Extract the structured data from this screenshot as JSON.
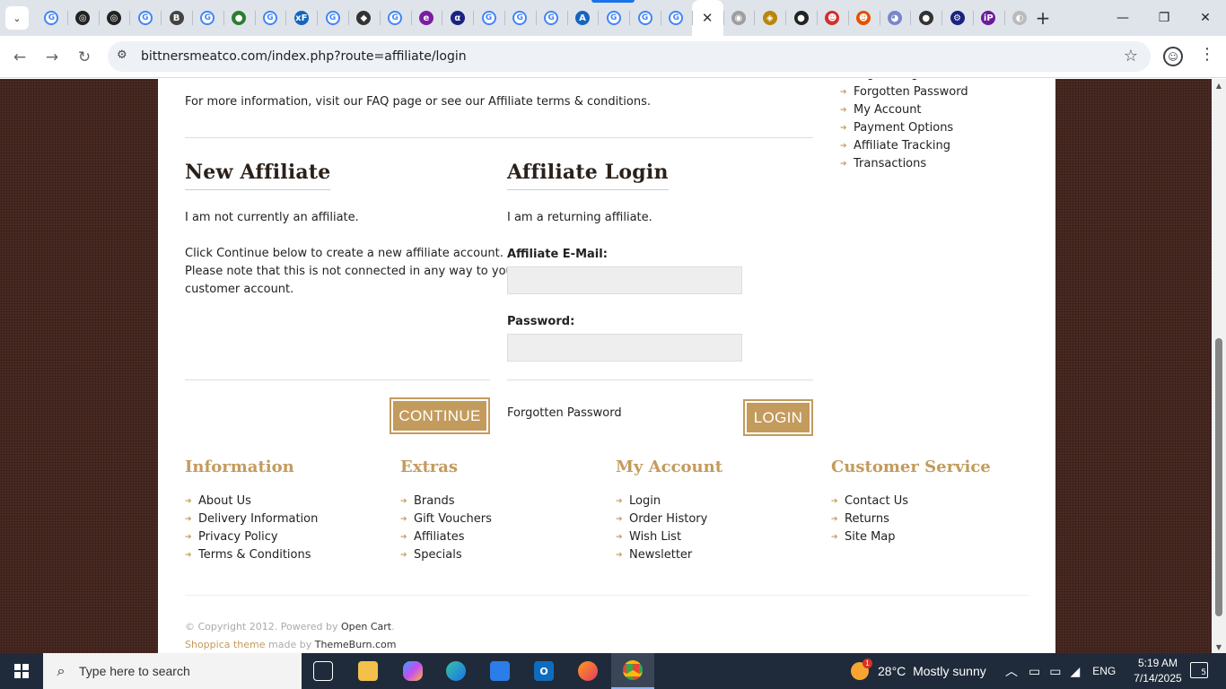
{
  "browser": {
    "url": "bittnersmeatco.com/index.php?route=affiliate/login",
    "new_tab": "+",
    "active_close": "✕",
    "tab_letters": [
      "G",
      "◎",
      "◎",
      "G",
      "B",
      "G",
      "●",
      "G",
      "xF",
      "G",
      "◆",
      "G",
      "e",
      "α",
      "G",
      "G",
      "G",
      "A",
      "G",
      "G",
      "G",
      "✕",
      "◉",
      "◈",
      "●",
      "☻",
      "☻",
      "◕",
      "●",
      "⚙",
      "iP",
      "◐"
    ]
  },
  "page": {
    "info_text": "For more information, visit our FAQ page or see our Affiliate terms & conditions.",
    "new_affiliate": {
      "heading": "New Affiliate",
      "line1": "I am not currently an affiliate.",
      "line2": "Click Continue below to create a new affiliate account.",
      "line3": "Please note that this is not connected in any way to your",
      "line4": "customer account.",
      "continue_label": "CONTINUE"
    },
    "affiliate_login": {
      "heading": "Affiliate Login",
      "line1": "I am a returning affiliate.",
      "email_label": "Affiliate E-Mail:",
      "email_value": "",
      "password_label": "Password:",
      "password_value": "",
      "forgotten_label": "Forgotten Password",
      "login_label": "LOGIN"
    },
    "side_menu": [
      "Login / Register",
      "Forgotten Password",
      "My Account",
      "Payment Options",
      "Affiliate Tracking",
      "Transactions"
    ]
  },
  "footer": {
    "columns": [
      {
        "title": "Information",
        "items": [
          "About Us",
          "Delivery Information",
          "Privacy Policy",
          "Terms & Conditions"
        ]
      },
      {
        "title": "Extras",
        "items": [
          "Brands",
          "Gift Vouchers",
          "Affiliates",
          "Specials"
        ]
      },
      {
        "title": "My Account",
        "items": [
          "Login",
          "Order History",
          "Wish List",
          "Newsletter"
        ]
      },
      {
        "title": "Customer Service",
        "items": [
          "Contact Us",
          "Returns",
          "Site Map"
        ]
      }
    ],
    "copyright_prefix": "© Copyright 2012. Powered by",
    "opencart": "Open Cart",
    "copyright_end": ".",
    "theme_name": "Shoppica theme",
    "made_by": "made by",
    "themeburn": "ThemeBurn.com"
  },
  "taskbar": {
    "search_placeholder": "Type here to search",
    "weather_temp": "28°C",
    "weather_text": "Mostly sunny",
    "language": "ENG",
    "time": "5:19 AM",
    "date": "7/14/2025",
    "notification_count": "5",
    "weather_badge": "1"
  },
  "colors": {
    "accent_gold": "#c39b5d",
    "page_background": "#4a2a22",
    "chrome_blue": "#1a73e8"
  }
}
